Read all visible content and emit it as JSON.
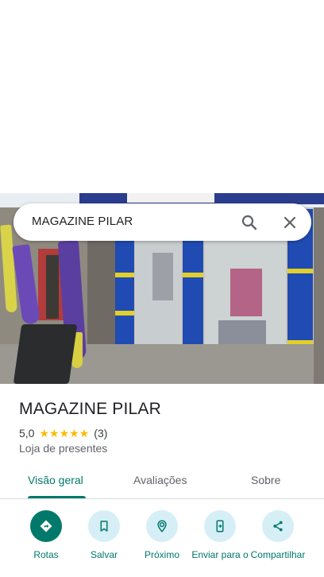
{
  "search": {
    "query": "MAGAZINE PILAR"
  },
  "place": {
    "name": "MAGAZINE PILAR",
    "rating": "5,0",
    "stars": 5,
    "review_count": "(3)",
    "category": "Loja de presentes"
  },
  "tabs": [
    {
      "label": "Visão geral",
      "active": true
    },
    {
      "label": "Avaliações",
      "active": false
    },
    {
      "label": "Sobre",
      "active": false
    }
  ],
  "actions": [
    {
      "label": "Rotas",
      "icon": "directions-icon"
    },
    {
      "label": "Salvar",
      "icon": "bookmark-icon"
    },
    {
      "label": "Próximo",
      "icon": "nearby-icon"
    },
    {
      "label": "Enviar para o",
      "icon": "send-to-phone-icon"
    },
    {
      "label": "Compartilhar",
      "icon": "share-icon"
    }
  ],
  "colors": {
    "accent": "#00796b",
    "action_bg": "#d6eff6",
    "star": "#fbbc04"
  }
}
